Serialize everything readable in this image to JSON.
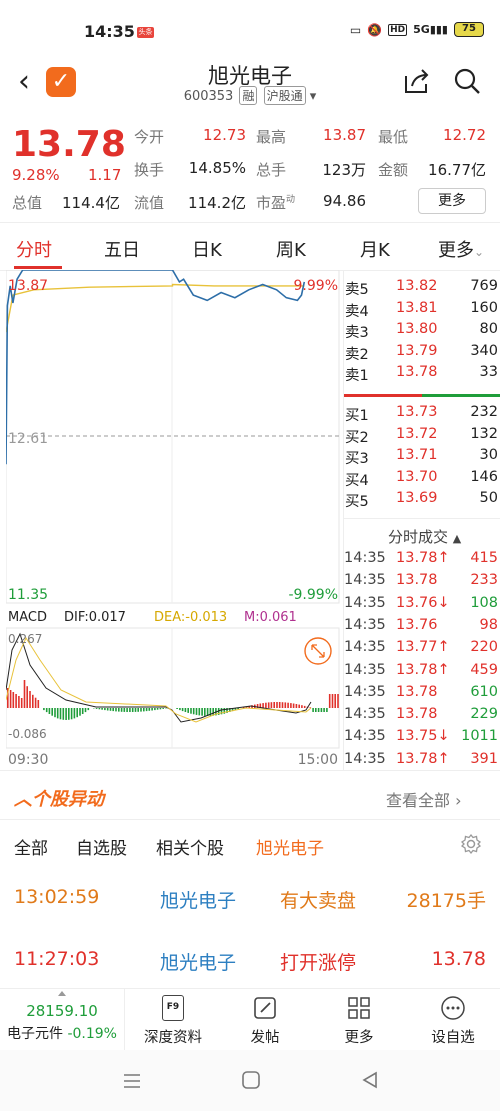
{
  "status_bar": {
    "time": "14:35",
    "badge": "头条",
    "network": "5G",
    "hd": "HD",
    "battery": "75"
  },
  "header": {
    "stock_name": "旭光电子",
    "code": "600353",
    "tag_margin": "融",
    "tag_market": "沪股通"
  },
  "quote": {
    "price": "13.78",
    "change_pct": "9.28%",
    "change": "1.17",
    "open_label": "今开",
    "open": "12.73",
    "high_label": "最高",
    "high": "13.87",
    "low_label": "最低",
    "low": "12.72",
    "turnover_label": "换手",
    "turnover": "14.85%",
    "volume_label": "总手",
    "volume": "123万",
    "amount_label": "金额",
    "amount": "16.77亿",
    "mktcap_label": "总值",
    "mktcap": "114.4亿",
    "float_label": "流值",
    "float": "114.2亿",
    "pe_label": "市盈",
    "pe_sup": "动",
    "pe": "94.86",
    "more_label": "更多"
  },
  "tabs": [
    "分时",
    "五日",
    "日K",
    "周K",
    "月K",
    "更多"
  ],
  "chart_labels": {
    "top_price": "13.87",
    "top_pct": "9.99%",
    "mid_price": "12.61",
    "bottom_price": "11.35",
    "bottom_pct": "-9.99%",
    "macd_title": "MACD",
    "dif": "DIF:0.017",
    "dea": "DEA:-0.013",
    "m": "M:0.061",
    "macd_top": "0.267",
    "macd_bottom": "-0.086",
    "time_start": "09:30",
    "time_end": "15:00"
  },
  "chart_data": {
    "type": "line",
    "title": "",
    "x_range": [
      "09:30",
      "15:00"
    ],
    "ylim": [
      11.35,
      13.87
    ],
    "reference_price": 12.61,
    "series": [
      {
        "values_desc": "price",
        "points": [
          [
            "09:30",
            12.4
          ],
          [
            "09:31",
            13.6
          ],
          [
            "09:33",
            13.75
          ],
          [
            "09:35",
            13.62
          ],
          [
            "09:38",
            13.8
          ],
          [
            "09:42",
            13.87
          ],
          [
            "10:30",
            13.87
          ],
          [
            "11:30",
            13.87
          ],
          [
            "13:00",
            13.87
          ],
          [
            "13:05",
            13.78
          ],
          [
            "13:08",
            13.8
          ],
          [
            "13:15",
            13.68
          ],
          [
            "13:25",
            13.64
          ],
          [
            "13:35",
            13.7
          ],
          [
            "13:45",
            13.66
          ],
          [
            "13:55",
            13.72
          ],
          [
            "14:05",
            13.76
          ],
          [
            "14:15",
            13.72
          ],
          [
            "14:22",
            13.66
          ],
          [
            "14:30",
            13.64
          ],
          [
            "14:33",
            13.68
          ],
          [
            "14:35",
            13.78
          ]
        ]
      },
      {
        "values_desc": "avg",
        "points": [
          [
            "09:30",
            13.4
          ],
          [
            "09:35",
            13.68
          ],
          [
            "09:50",
            13.72
          ],
          [
            "10:30",
            13.74
          ],
          [
            "11:30",
            13.75
          ],
          [
            "13:00",
            13.76
          ],
          [
            "13:30",
            13.75
          ],
          [
            "14:00",
            13.75
          ],
          [
            "14:35",
            13.75
          ]
        ]
      }
    ]
  },
  "orderbook": {
    "asks": [
      {
        "label": "卖5",
        "price": "13.82",
        "vol": "769"
      },
      {
        "label": "卖4",
        "price": "13.81",
        "vol": "160"
      },
      {
        "label": "卖3",
        "price": "13.80",
        "vol": "80"
      },
      {
        "label": "卖2",
        "price": "13.79",
        "vol": "340"
      },
      {
        "label": "卖1",
        "price": "13.78",
        "vol": "33"
      }
    ],
    "bids": [
      {
        "label": "买1",
        "price": "13.73",
        "vol": "232"
      },
      {
        "label": "买2",
        "price": "13.72",
        "vol": "132"
      },
      {
        "label": "买3",
        "price": "13.71",
        "vol": "30"
      },
      {
        "label": "买4",
        "price": "13.70",
        "vol": "146"
      },
      {
        "label": "买5",
        "price": "13.69",
        "vol": "50"
      }
    ]
  },
  "ticks": {
    "title": "分时成交",
    "rows": [
      {
        "time": "14:35",
        "price": "13.78↑",
        "vol": "415",
        "color": "red"
      },
      {
        "time": "14:35",
        "price": "13.78",
        "vol": "233",
        "color": "red"
      },
      {
        "time": "14:35",
        "price": "13.76↓",
        "vol": "108",
        "color": "green"
      },
      {
        "time": "14:35",
        "price": "13.76",
        "vol": "98",
        "color": "red"
      },
      {
        "time": "14:35",
        "price": "13.77↑",
        "vol": "220",
        "color": "red"
      },
      {
        "time": "14:35",
        "price": "13.78↑",
        "vol": "459",
        "color": "red"
      },
      {
        "time": "14:35",
        "price": "13.78",
        "vol": "610",
        "color": "green"
      },
      {
        "time": "14:35",
        "price": "13.78",
        "vol": "229",
        "color": "green"
      },
      {
        "time": "14:35",
        "price": "13.75↓",
        "vol": "1011",
        "color": "green"
      },
      {
        "time": "14:35",
        "price": "13.78↑",
        "vol": "391",
        "color": "red"
      }
    ]
  },
  "events": {
    "title": "个股异动",
    "view_all": "查看全部",
    "filters": [
      "全部",
      "自选股",
      "相关个股",
      "旭光电子"
    ],
    "items": [
      {
        "time": "13:02:59",
        "stock": "旭光电子",
        "desc": "有大卖盘",
        "value": "28175手"
      },
      {
        "time": "11:27:03",
        "stock": "旭光电子",
        "desc": "打开涨停",
        "value": "13.78"
      }
    ]
  },
  "bottom_bar": {
    "index_value": "28159.10",
    "index_name": "电子元件",
    "index_change": "-0.19%",
    "items": [
      "深度资料",
      "发帖",
      "更多",
      "设自选"
    ],
    "f9": "F9"
  },
  "colors": {
    "up": "#e0312b",
    "down": "#1f9d3a",
    "accent": "#f26b1d",
    "price_line": "#2d6ea8",
    "avg_line": "#e8c23a"
  }
}
